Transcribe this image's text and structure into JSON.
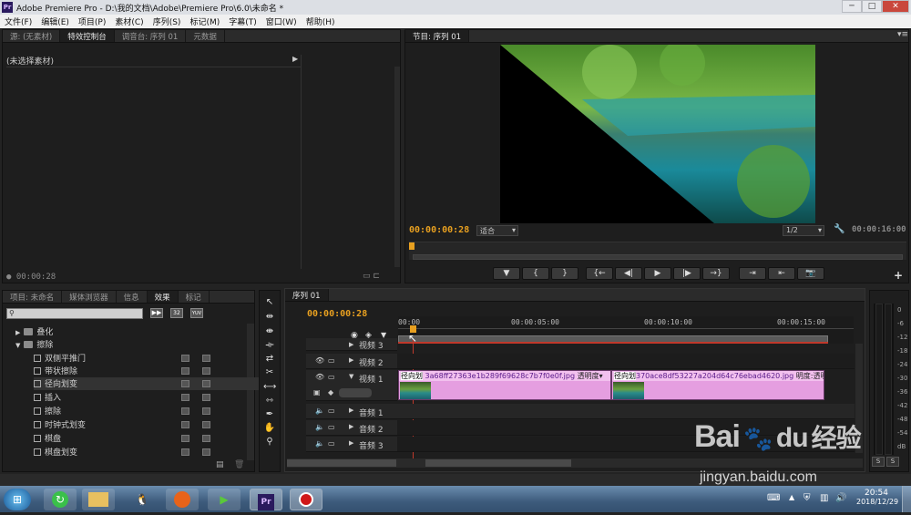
{
  "window": {
    "title": "Adobe Premiere Pro - D:\\我的文档\\Adobe\\Premiere Pro\\6.0\\未命名 *",
    "logo": "Pr",
    "controls": [
      "─",
      "□",
      "✕"
    ]
  },
  "menu": [
    "文件(F)",
    "编辑(E)",
    "项目(P)",
    "素材(C)",
    "序列(S)",
    "标记(M)",
    "字幕(T)",
    "窗口(W)",
    "帮助(H)"
  ],
  "source_panel": {
    "tabs": [
      "源: (无素材)",
      "特效控制台",
      "调音台: 序列 01",
      "元数据"
    ],
    "active_tab": "特效控制台",
    "header": "(未选择素材)",
    "timecode": "00:00:28"
  },
  "program_panel": {
    "tab": "节目: 序列 01",
    "timecode": "00:00:00:28",
    "fit": "适合",
    "quality": "1/2",
    "duration": "00:00:16:00",
    "buttons": [
      "▼",
      "{",
      "}",
      "{←",
      "◀|",
      "▶",
      "|▶",
      "→}",
      "⇥",
      "⇤",
      "📷"
    ]
  },
  "project_panel": {
    "tabs": [
      "项目: 未命名",
      "媒体浏览器",
      "信息",
      "效果",
      "标记"
    ],
    "active_tab": "效果",
    "search_placeholder": "",
    "badges": [
      "32",
      "YUV"
    ],
    "tree": [
      {
        "type": "folder",
        "label": "叠化",
        "expanded": false
      },
      {
        "type": "folder",
        "label": "擦除",
        "expanded": true
      },
      {
        "type": "item",
        "label": "双侧平推门"
      },
      {
        "type": "item",
        "label": "带状擦除"
      },
      {
        "type": "item",
        "label": "径向划变",
        "selected": true
      },
      {
        "type": "item",
        "label": "插入"
      },
      {
        "type": "item",
        "label": "擦除"
      },
      {
        "type": "item",
        "label": "时钟式划变"
      },
      {
        "type": "item",
        "label": "棋盘"
      },
      {
        "type": "item",
        "label": "棋盘划变"
      }
    ]
  },
  "timeline": {
    "tab": "序列 01",
    "timecode": "00:00:00:28",
    "ruler": [
      "00:00",
      "00:00:05:00",
      "00:00:10:00",
      "00:00:15:00"
    ],
    "tracks": {
      "video3": "视频 3",
      "video2": "视频 2",
      "video1": "视频 1",
      "audio1": "音频 1",
      "audio2": "音频 2",
      "audio3": "音频 3"
    },
    "clips": [
      {
        "transition": "径向划",
        "name": "3a68ff27363e1b289f69628c7b7f0e0f.jpg",
        "prop": "透明度"
      },
      {
        "transition": "径向划",
        "name": "370ace8df53227a204d64c76ebad4620.jpg",
        "prop": "明度:透明度"
      }
    ]
  },
  "vu_meter": {
    "labels": [
      "0",
      "-6",
      "-12",
      "-18",
      "-24",
      "-30",
      "-36",
      "-42",
      "-48",
      "-54",
      "dB"
    ],
    "buttons": [
      "S",
      "S"
    ]
  },
  "taskbar": {
    "clock_time": "20:54",
    "clock_date": "2018/12/29",
    "apps": [
      "start",
      "360",
      "explorer",
      "qq",
      "firefox",
      "camtasia",
      "premiere",
      "recorder"
    ]
  },
  "watermark": {
    "brand": "Bai",
    "paw": "du",
    "cn": "经验",
    "url": "jingyan.baidu.com"
  },
  "colors": {
    "accent": "#e8a020",
    "clip": "#e59ee0",
    "panel": "#1e1e1e"
  }
}
